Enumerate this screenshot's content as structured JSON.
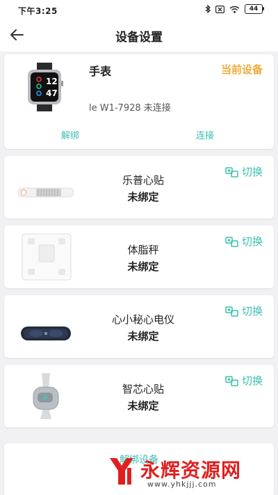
{
  "status_bar": {
    "time": "下午3:25",
    "battery": "44",
    "icons": [
      "bluetooth-icon",
      "sim-off-icon",
      "wifi-icon",
      "battery-icon"
    ]
  },
  "header": {
    "title": "设备设置",
    "back_icon": "back-arrow-icon"
  },
  "watch": {
    "name": "手表",
    "badge": "当前设备",
    "status": "le W1-7928 未连接",
    "watch_face_time": [
      "12",
      "47"
    ],
    "unbind_label": "解绑",
    "connect_label": "连接"
  },
  "devices": [
    {
      "name": "乐普心贴",
      "status": "未绑定",
      "switch_label": "切换",
      "icon": "patch-strip-icon"
    },
    {
      "name": "体脂秤",
      "status": "未绑定",
      "switch_label": "切换",
      "icon": "scale-icon"
    },
    {
      "name": "心小秘心电仪",
      "status": "未绑定",
      "switch_label": "切换",
      "icon": "ecg-device-icon"
    },
    {
      "name": "智芯心贴",
      "status": "未绑定",
      "switch_label": "切换",
      "icon": "smart-patch-icon"
    }
  ],
  "bottom": {
    "link_label": "解绑设备"
  },
  "watermark": {
    "text": "永辉资源网",
    "url": "www.yhkjjj.com"
  },
  "colors": {
    "accent": "#3bbfae",
    "badge": "#f0a93a",
    "watermark": "#e02020",
    "background": "#f1f1f3"
  }
}
